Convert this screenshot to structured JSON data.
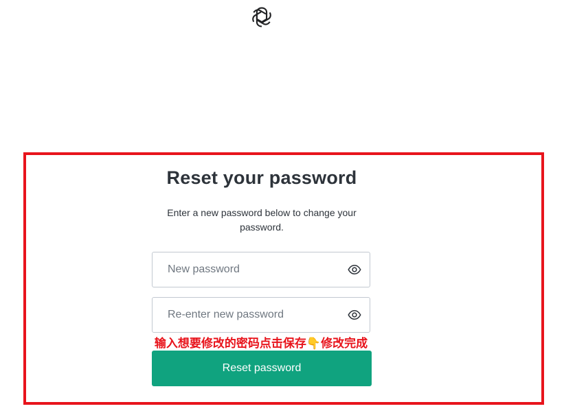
{
  "brand": {
    "logo_icon": "openai-logo-icon",
    "accent_color": "#10a37f"
  },
  "form": {
    "title": "Reset your password",
    "subtitle": "Enter a new password below to change your password.",
    "new_password": {
      "placeholder": "New password",
      "value": "",
      "toggle_icon": "eye-icon"
    },
    "confirm_password": {
      "placeholder": "Re-enter new password",
      "value": "",
      "toggle_icon": "eye-icon"
    },
    "submit_label": "Reset password"
  },
  "annotation": {
    "text": "输入想要修改的密码点击保存👇修改完成",
    "color": "#e8141c",
    "box_color": "#e8141c"
  }
}
